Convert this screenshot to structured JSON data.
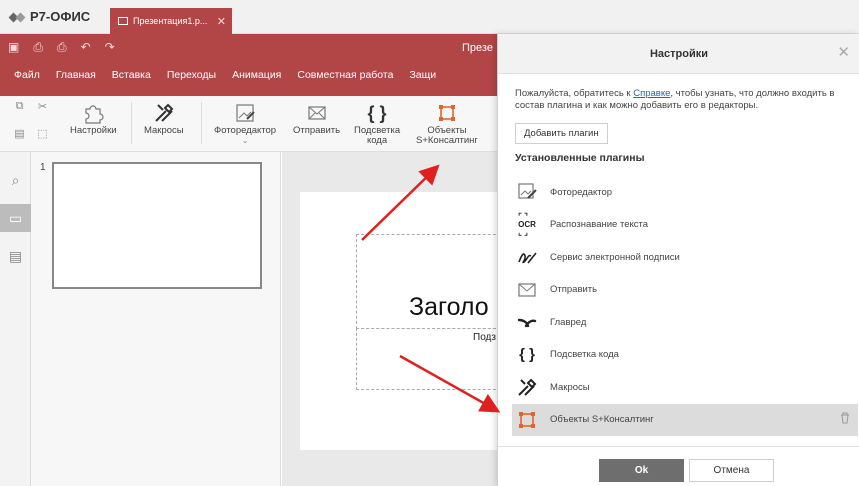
{
  "app": {
    "name": "Р7-ОФИС",
    "doc_tab": "Презентация1.p..."
  },
  "header": {
    "doc_title": "Презе"
  },
  "menu": [
    "Файл",
    "Главная",
    "Вставка",
    "Переходы",
    "Анимация",
    "Совместная работа",
    "Защи"
  ],
  "toolbar": {
    "settings": "Настройки",
    "macros": "Макросы",
    "photo_editor": "Фоторедактор",
    "send": "Отправить",
    "highlight_line1": "Подсветка",
    "highlight_line2": "кода",
    "objects_line1": "Объекты",
    "objects_line2": "S+Консалтинг"
  },
  "thumbnail": {
    "number": "1"
  },
  "slide": {
    "title": "Заголо",
    "subtitle": "Подз"
  },
  "dialog": {
    "title": "Настройки",
    "info_pre": "Пожалуйста, обратитесь к ",
    "info_link": "Справке",
    "info_post": ", чтобы узнать, что должно входить в состав плагина и как можно добавить его в редакторы.",
    "add_button": "Добавить плагин",
    "installed_heading": "Установленные плагины",
    "plugins": [
      {
        "label": "Фоторедактор",
        "icon": "photo-editor-icon"
      },
      {
        "label": "Распознавание текста",
        "icon": "ocr-icon"
      },
      {
        "label": "Сервис электронной подписи",
        "icon": "signature-icon"
      },
      {
        "label": "Отправить",
        "icon": "envelope-icon"
      },
      {
        "label": "Главред",
        "icon": "glavred-icon"
      },
      {
        "label": "Подсветка кода",
        "icon": "braces-icon"
      },
      {
        "label": "Макросы",
        "icon": "tools-icon"
      },
      {
        "label": "Объекты S+Консалтинг",
        "icon": "bounding-box-icon"
      }
    ],
    "ok_button": "Ok",
    "cancel_button": "Отмена"
  },
  "colors": {
    "brand_red": "#b24647",
    "accent_orange": "#e2642a",
    "arrow_red": "#e02020"
  }
}
